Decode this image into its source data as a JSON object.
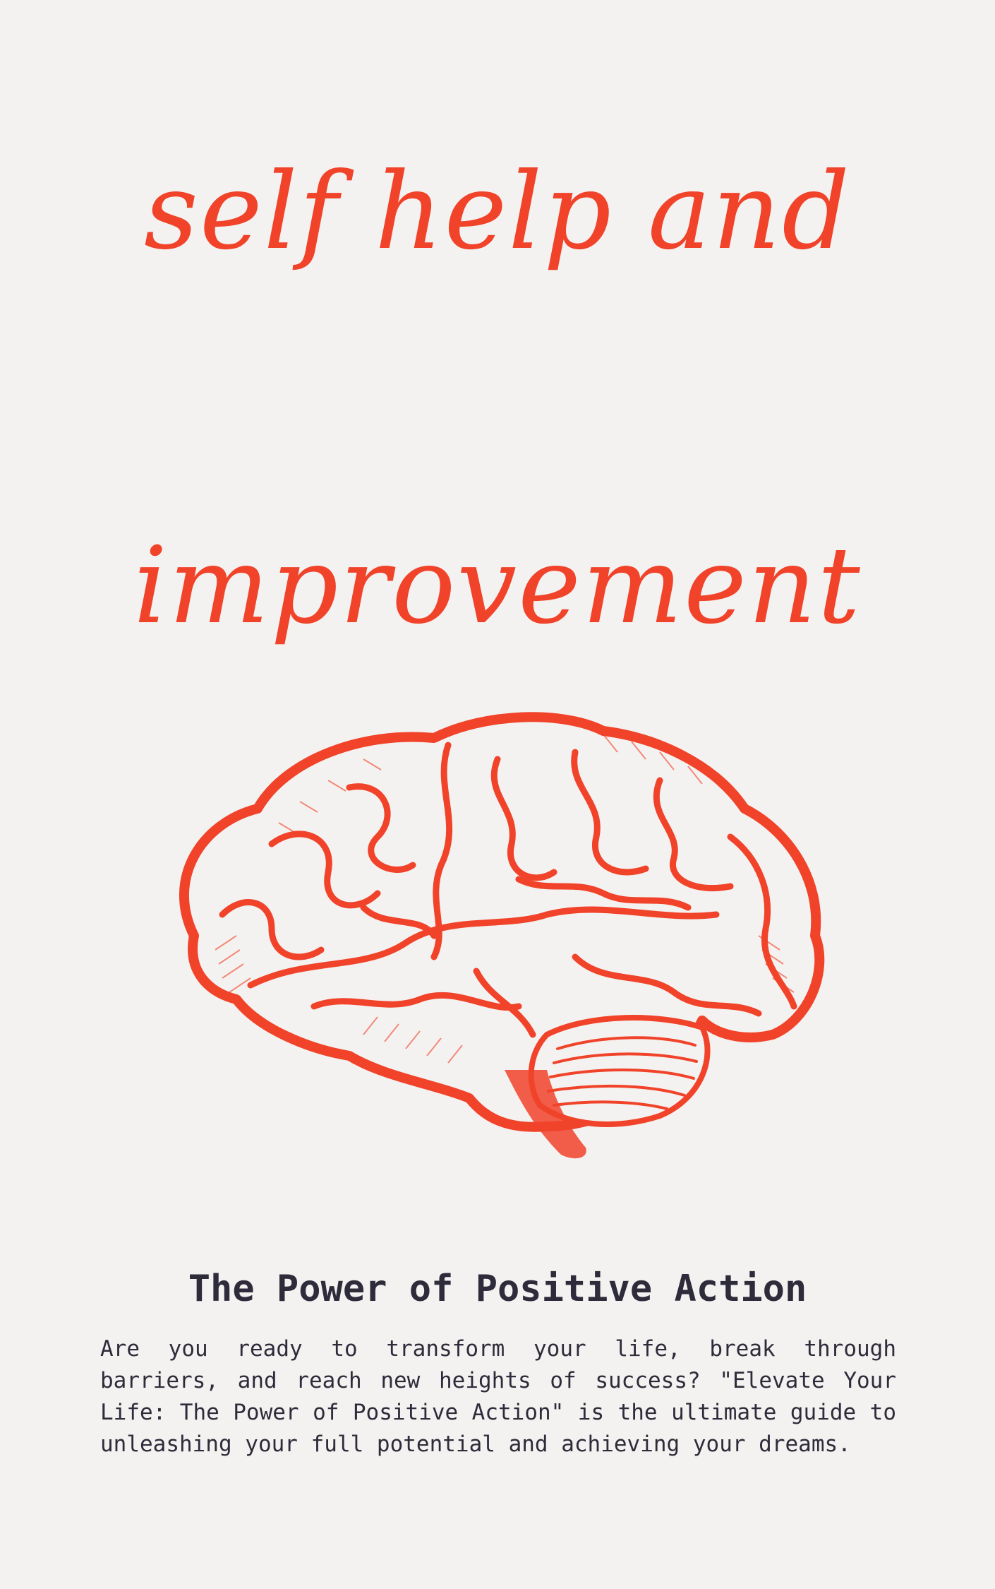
{
  "cover": {
    "script_line_1": "self help and",
    "script_line_2": "improvement",
    "subtitle": "The Power of Positive Action",
    "blurb": "Are you ready to transform your life, break through barriers, and reach new heights of success? \"Elevate Your Life: The Power of Positive Action\" is the ultimate guide to unleashing your full potential and achieving your dreams.",
    "illustration_icon": "brain-icon"
  },
  "colors": {
    "background": "#f4f2f0",
    "accent": "#f0432a",
    "text": "#2e2c3a"
  }
}
